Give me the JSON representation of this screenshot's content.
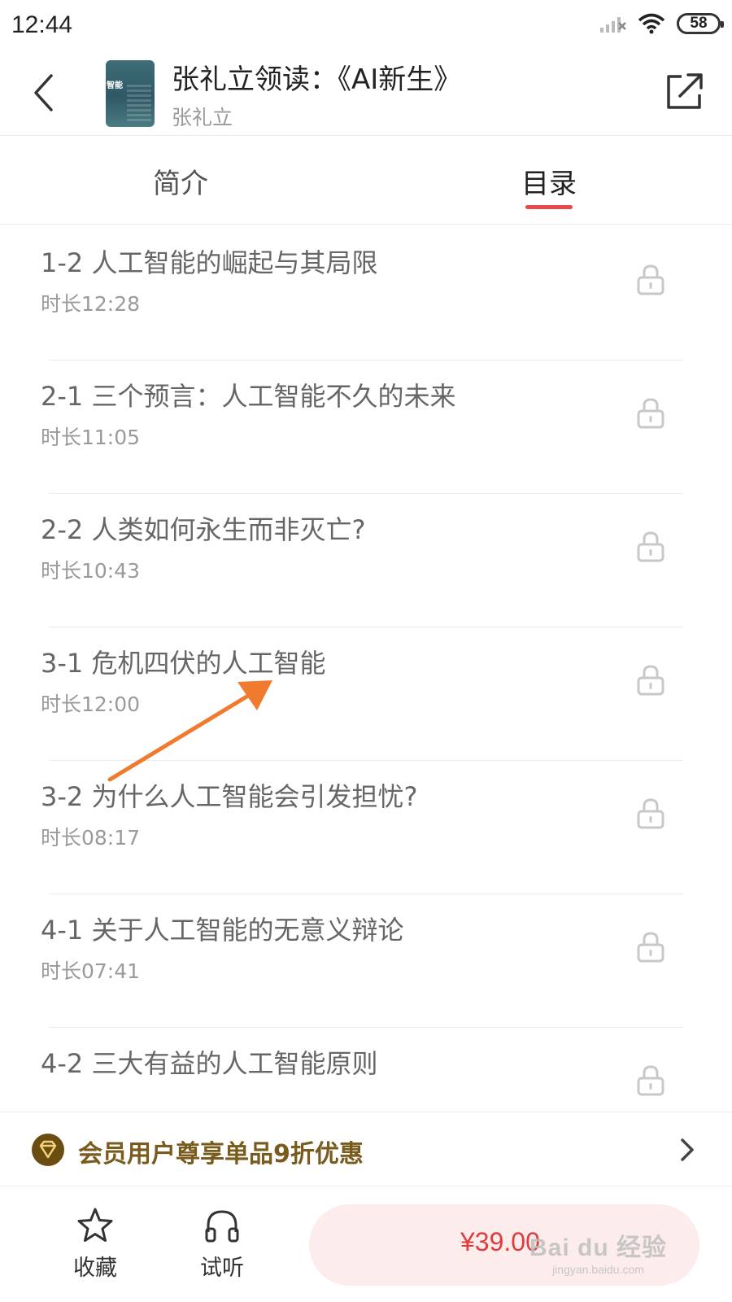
{
  "status_bar": {
    "time": "12:44",
    "battery": "58"
  },
  "header": {
    "title": "张礼立领读：《AI新生》",
    "author": "张礼立",
    "cover_text": "智能"
  },
  "tabs": [
    {
      "label": "简介",
      "active": false
    },
    {
      "label": "目录",
      "active": true
    }
  ],
  "chapters": [
    {
      "title": "1-2 人工智能的崛起与其局限",
      "duration": "时长12:28",
      "locked": true
    },
    {
      "title": "2-1 三个预言：人工智能不久的未来",
      "duration": "时长11:05",
      "locked": true
    },
    {
      "title": "2-2 人类如何永生而非灭亡?",
      "duration": "时长10:43",
      "locked": true
    },
    {
      "title": "3-1 危机四伏的人工智能",
      "duration": "时长12:00",
      "locked": true
    },
    {
      "title": "3-2 为什么人工智能会引发担忧?",
      "duration": "时长08:17",
      "locked": true
    },
    {
      "title": "4-1 关于人工智能的无意义辩论",
      "duration": "时长07:41",
      "locked": true
    },
    {
      "title": "4-2 三大有益的人工智能原则",
      "duration": "",
      "locked": true
    }
  ],
  "member_banner": {
    "text": "会员用户尊享单品9折优惠"
  },
  "bottom_bar": {
    "favorite_label": "收藏",
    "listen_label": "试听",
    "price": "¥39.00"
  },
  "watermark": {
    "main": "Bai du 经验",
    "sub": "jingyan.baidu.com"
  },
  "colors": {
    "accent": "#e84a4a",
    "price": "#e03c3c",
    "buy_bg": "#fdecec",
    "member_gold": "#7a5b1e",
    "annotation": "#f07a2e"
  }
}
